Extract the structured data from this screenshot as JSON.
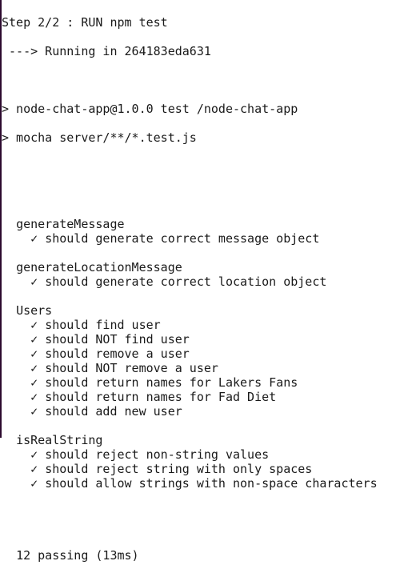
{
  "header": {
    "step": "Step 2/2 : RUN npm test",
    "running": " ---> Running in 264183eda631",
    "npm_line": "> node-chat-app@1.0.0 test /node-chat-app",
    "mocha_line": "> mocha server/**/*.test.js"
  },
  "suites": [
    {
      "name": "generateMessage",
      "tests": [
        "should generate correct message object"
      ]
    },
    {
      "name": "generateLocationMessage",
      "tests": [
        "should generate correct location object"
      ]
    },
    {
      "name": "Users",
      "tests": [
        "should find user",
        "should NOT find user",
        "should remove a user",
        "should NOT remove a user",
        "should return names for Lakers Fans",
        "should return names for Fad Diet",
        "should add new user"
      ]
    },
    {
      "name": "isRealString",
      "tests": [
        "should reject non-string values",
        "should reject string with only spaces",
        "should allow strings with non-space characters"
      ]
    }
  ],
  "check_mark": "✓",
  "summary": "12 passing (13ms)"
}
